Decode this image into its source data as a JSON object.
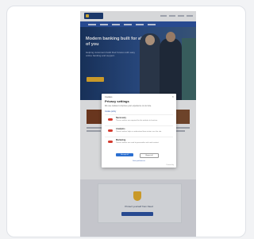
{
  "hero": {
    "title": "Modern banking built for all of you",
    "subtitle": "Helping customers build their futures with easy online banking and support."
  },
  "privacy_modal": {
    "header": "Cookies",
    "close": "×",
    "title": "Privacy settings",
    "description": "We use cookies to improve your experience on our site.",
    "link": "Cookie policy",
    "rows": [
      {
        "title": "Necessary",
        "text": "These cookies are required for the website to function."
      },
      {
        "title": "Analytics",
        "text": "These cookies help us understand how visitors use the site."
      },
      {
        "title": "Marketing",
        "text": "These cookies are used to personalise ads and content."
      }
    ],
    "accept_label": "Accept all",
    "reject_label": "Reject all",
    "footer_link": "Save preferences",
    "powered": "Powered by"
  },
  "callout": {
    "text": "Protect yourself from fraud"
  },
  "colors": {
    "brand": "#2b54a6",
    "accent": "#f0b429",
    "toggle": "#d43b2f"
  }
}
